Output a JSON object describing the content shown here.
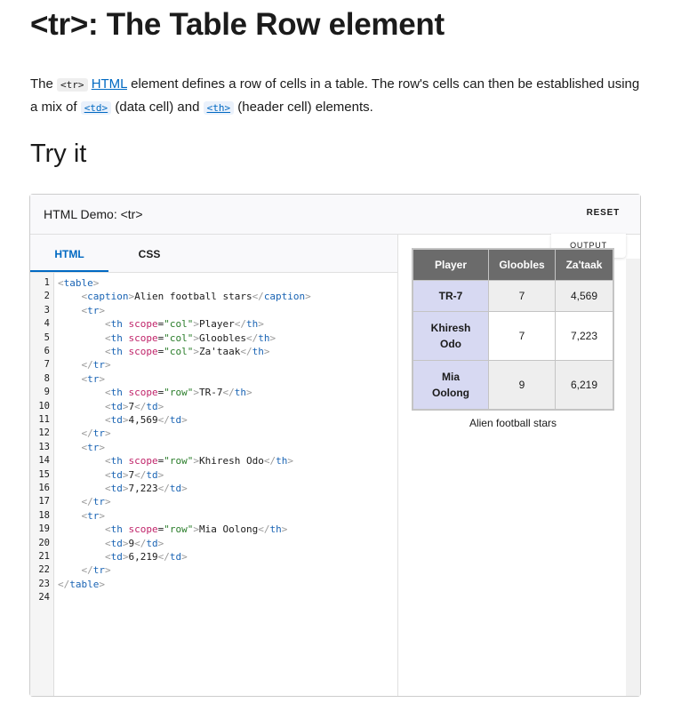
{
  "page": {
    "title": "<tr>: The Table Row element",
    "intro": {
      "p1": "The ",
      "code1": "<tr>",
      "link1": "HTML",
      "p2": " element defines a row of cells in a table. The row's cells can then be established using a mix of ",
      "code_td": "<td>",
      "p3": " (data cell) and ",
      "code_th": "<th>",
      "p4": " (header cell) elements."
    },
    "section_title": "Try it"
  },
  "demo": {
    "title": "HTML Demo: <tr>",
    "reset_label": "RESET",
    "tabs": [
      "HTML",
      "CSS"
    ],
    "output_label": "OUTPUT",
    "code_lines": [
      "<table>",
      "    <caption>Alien football stars</caption>",
      "    <tr>",
      "        <th scope=\"col\">Player</th>",
      "        <th scope=\"col\">Gloobles</th>",
      "        <th scope=\"col\">Za'taak</th>",
      "    </tr>",
      "    <tr>",
      "        <th scope=\"row\">TR-7</th>",
      "        <td>7</td>",
      "        <td>4,569</td>",
      "    </tr>",
      "    <tr>",
      "        <th scope=\"row\">Khiresh Odo</th>",
      "        <td>7</td>",
      "        <td>7,223</td>",
      "    </tr>",
      "    <tr>",
      "        <th scope=\"row\">Mia Oolong</th>",
      "        <td>9</td>",
      "        <td>6,219</td>",
      "    </tr>",
      "</table>",
      ""
    ]
  },
  "output_table": {
    "headers": [
      "Player",
      "Gloobles",
      "Za'taak"
    ],
    "rows": [
      {
        "player_lines": [
          "TR-7"
        ],
        "gloobles": "7",
        "zataak": "4,569"
      },
      {
        "player_lines": [
          "Khiresh",
          "Odo"
        ],
        "gloobles": "7",
        "zataak": "7,223"
      },
      {
        "player_lines": [
          "Mia",
          "Oolong"
        ],
        "gloobles": "9",
        "zataak": "6,219"
      }
    ],
    "caption": "Alien football stars"
  }
}
